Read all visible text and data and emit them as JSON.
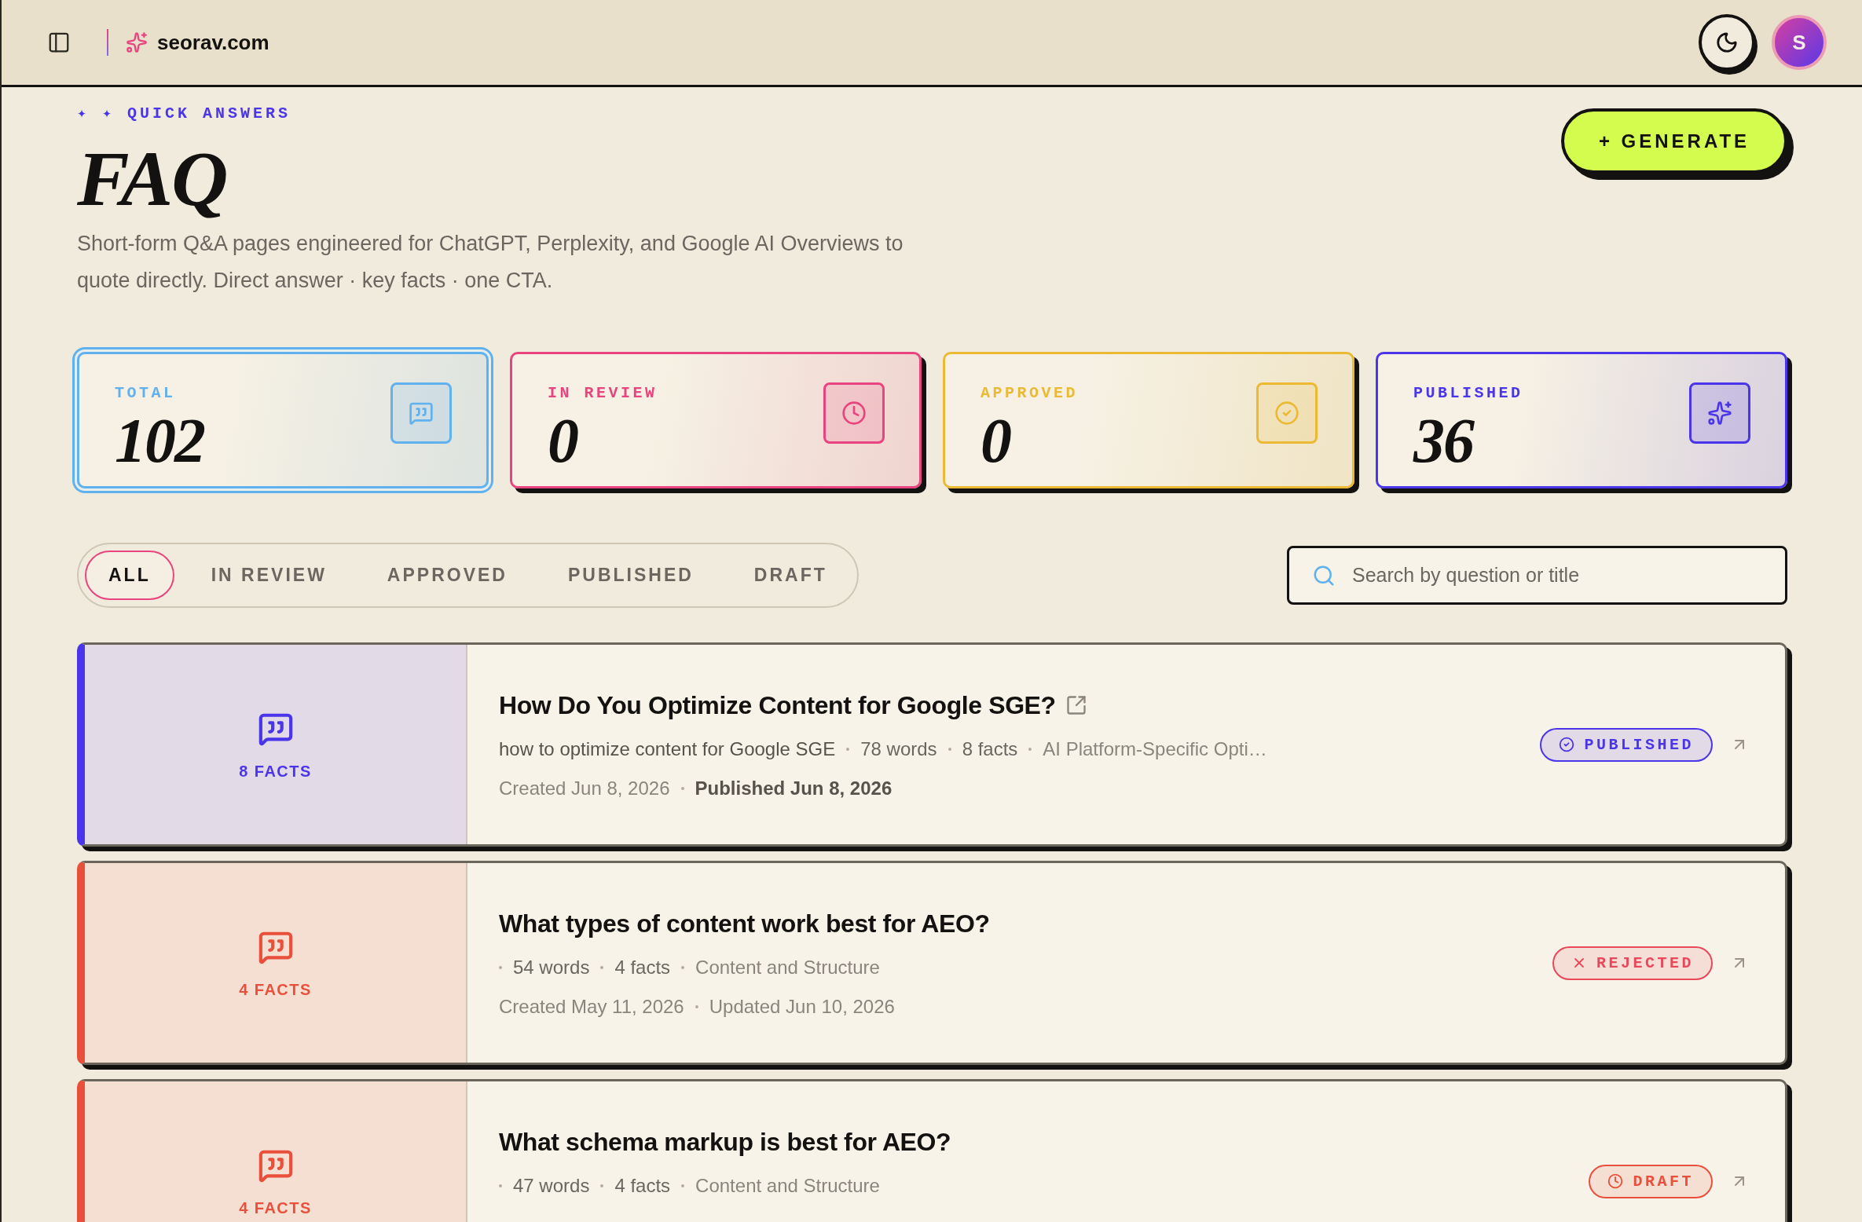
{
  "topbar": {
    "site_name": "seorav.com",
    "avatar_initial": "S"
  },
  "hero": {
    "eyebrow": "✦ ✦ QUICK ANSWERS",
    "title": "FAQ",
    "description": "Short-form Q&A pages engineered for ChatGPT, Perplexity, and Google AI Overviews to quote directly. Direct answer · key facts · one CTA.",
    "generate_button": "+ GENERATE"
  },
  "stats": [
    {
      "kind": "total",
      "label": "TOTAL",
      "value": "102",
      "color": "#62b1ef",
      "selected": true
    },
    {
      "kind": "review",
      "label": "IN REVIEW",
      "value": "0",
      "color": "#e8447f",
      "selected": false
    },
    {
      "kind": "approved",
      "label": "APPROVED",
      "value": "0",
      "color": "#ebb933",
      "selected": false
    },
    {
      "kind": "published",
      "label": "PUBLISHED",
      "value": "36",
      "color": "#4b35ea",
      "selected": false
    }
  ],
  "filters": [
    {
      "label": "ALL",
      "selected": true
    },
    {
      "label": "IN REVIEW",
      "selected": false
    },
    {
      "label": "APPROVED",
      "selected": false
    },
    {
      "label": "PUBLISHED",
      "selected": false
    },
    {
      "label": "DRAFT",
      "selected": false
    }
  ],
  "search": {
    "placeholder": "Search by question or title"
  },
  "faqs": [
    {
      "title": "How Do You Optimize Content for Google SGE?",
      "external_link": true,
      "color": "#4b35ea",
      "facts_label": "8 FACTS",
      "keyword": "how to optimize content for Google SGE",
      "words": "78 words",
      "facts": "8 facts",
      "category": "AI Platform-Specific Opti…",
      "dates": [
        {
          "text": "Created Jun 8, 2026",
          "strong": false
        },
        {
          "text": "Published Jun 8, 2026",
          "strong": true
        }
      ],
      "status": {
        "kind": "published",
        "label": "PUBLISHED"
      }
    },
    {
      "title": "What types of content work best for AEO?",
      "external_link": false,
      "color": "#e9503c",
      "facts_label": "4 FACTS",
      "words": "54 words",
      "facts": "4 facts",
      "category": "Content and Structure",
      "dates": [
        {
          "text": "Created May 11, 2026",
          "strong": false
        },
        {
          "text": "Updated Jun 10, 2026",
          "strong": false
        }
      ],
      "status": {
        "kind": "rejected",
        "label": "REJECTED"
      }
    },
    {
      "title": "What schema markup is best for AEO?",
      "external_link": false,
      "color": "#e9503c",
      "facts_label": "4 FACTS",
      "words": "47 words",
      "facts": "4 facts",
      "category": "Content and Structure",
      "status": {
        "kind": "draft",
        "label": "DRAFT"
      }
    }
  ]
}
